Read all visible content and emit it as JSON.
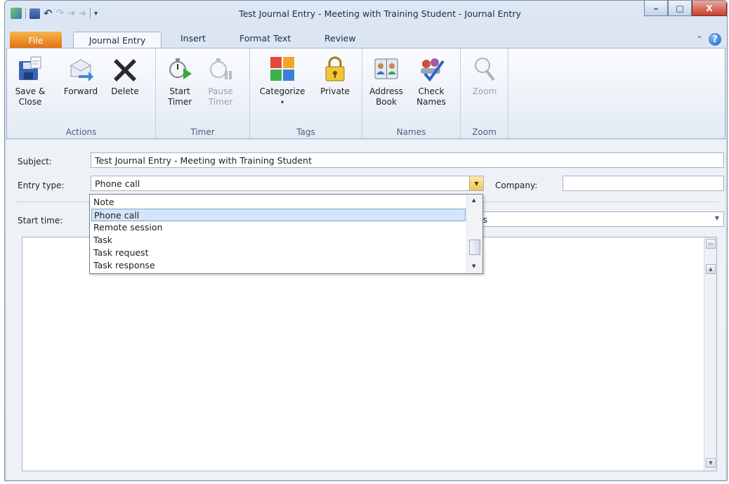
{
  "window": {
    "title": "Test Journal Entry - Meeting with Training Student  -  Journal Entry",
    "controls": {
      "minimize": "–",
      "maximize": "□",
      "close": "X"
    }
  },
  "tabs": [
    "File",
    "Journal Entry",
    "Insert",
    "Format Text",
    "Review"
  ],
  "ribbon": {
    "groups": [
      {
        "label": "Actions",
        "buttons": [
          {
            "line1": "Save &",
            "line2": "Close"
          },
          {
            "line1": "Forward",
            "line2": ""
          },
          {
            "line1": "Delete",
            "line2": ""
          }
        ]
      },
      {
        "label": "Timer",
        "buttons": [
          {
            "line1": "Start",
            "line2": "Timer"
          },
          {
            "line1": "Pause",
            "line2": "Timer"
          }
        ]
      },
      {
        "label": "Tags",
        "buttons": [
          {
            "line1": "Categorize",
            "line2": "▾"
          },
          {
            "line1": "Private",
            "line2": ""
          }
        ]
      },
      {
        "label": "Names",
        "buttons": [
          {
            "line1": "Address",
            "line2": "Book"
          },
          {
            "line1": "Check",
            "line2": "Names"
          }
        ]
      },
      {
        "label": "Zoom",
        "buttons": [
          {
            "line1": "Zoom",
            "line2": ""
          }
        ]
      }
    ]
  },
  "form": {
    "subject_label": "Subject:",
    "subject_value": "Test Journal Entry - Meeting with Training Student",
    "entry_type_label": "Entry type:",
    "entry_type_value": "Phone call",
    "company_label": "Company:",
    "company_value": "",
    "start_time_label": "Start time:",
    "duration_partial": "tes"
  },
  "entry_type_options": [
    "Note",
    "Phone call",
    "Remote session",
    "Task",
    "Task request",
    "Task response"
  ],
  "selected_option_index": 1,
  "colors": {
    "file_tab": "#e16f12",
    "selection": "#d3e5fa",
    "close_button": "#c6412c"
  }
}
